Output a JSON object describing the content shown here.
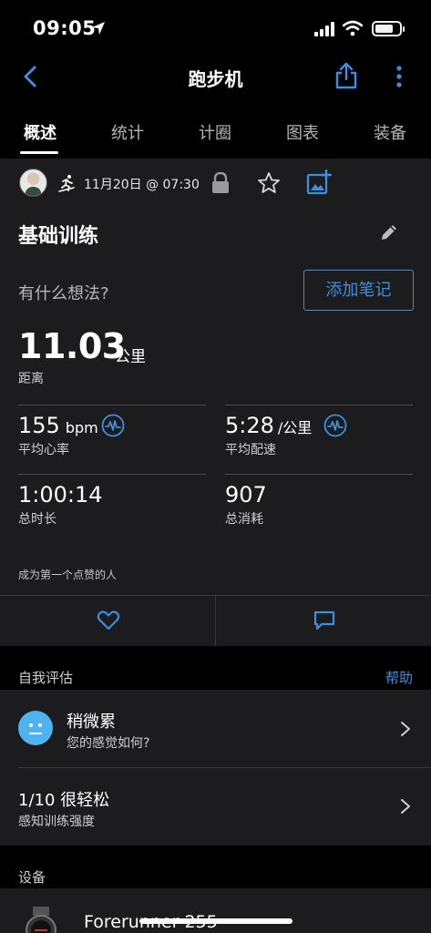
{
  "status_bar": {
    "time": "09:05"
  },
  "nav": {
    "title": "跑步机"
  },
  "tabs": [
    {
      "label": "概述",
      "active": true
    },
    {
      "label": "统计",
      "active": false
    },
    {
      "label": "计圈",
      "active": false
    },
    {
      "label": "图表",
      "active": false
    },
    {
      "label": "装备",
      "active": false
    }
  ],
  "activity": {
    "datetime": "11月20日 @ 07:30",
    "name": "基础训练",
    "thoughts_prompt": "有什么想法?",
    "add_note_label": "添加笔记",
    "distance": {
      "value": "11.03",
      "unit": "公里",
      "label": "距离"
    },
    "stats": {
      "heart_rate": {
        "value": "155",
        "unit": "bpm",
        "label": "平均心率"
      },
      "pace": {
        "value": "5:28",
        "unit": "/公里",
        "label": "平均配速"
      },
      "duration": {
        "value": "1:00:14",
        "label": "总时长"
      },
      "calories": {
        "value": "907",
        "label": "总消耗"
      }
    },
    "first_like": "成为第一个点赞的人"
  },
  "self_eval": {
    "section_title": "自我评估",
    "help_label": "帮助",
    "feel": {
      "title": "稍微累",
      "subtitle": "您的感觉如何?"
    },
    "effort": {
      "title": "1/10 很轻松",
      "subtitle": "感知训练强度"
    }
  },
  "device": {
    "section_title": "设备",
    "name": "Forerunner 255"
  },
  "colors": {
    "accent": "#3c8fe0",
    "background": "#000000",
    "card": "#1c1c1e",
    "face_icon": "#4fb3f0"
  },
  "icons": [
    "location-arrow-icon",
    "signal-icon",
    "wifi-icon",
    "battery-icon",
    "back-icon",
    "share-icon",
    "more-icon",
    "treadmill-run-icon",
    "lock-icon",
    "star-icon",
    "add-photo-icon",
    "edit-icon",
    "graph-icon",
    "heart-icon",
    "comment-icon",
    "face-icon",
    "chevron-right-icon",
    "watch-icon"
  ]
}
